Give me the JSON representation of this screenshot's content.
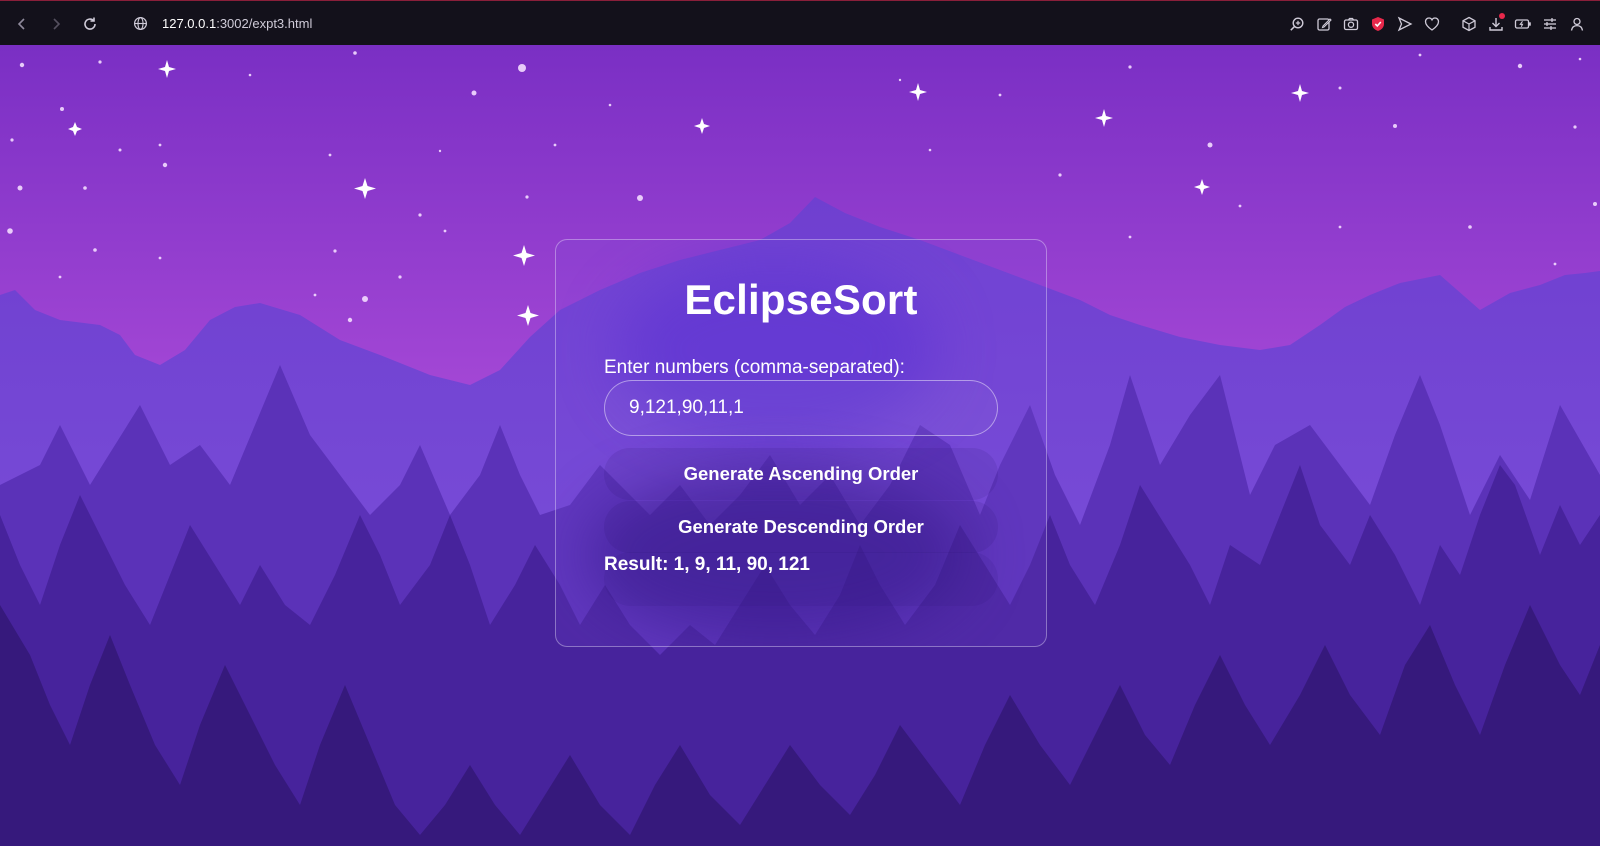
{
  "browser": {
    "url_host": "127.0.0.1",
    "url_path": ":3002/expt3.html",
    "icons": [
      "back-icon",
      "forward-icon",
      "reload-icon",
      "globe-icon",
      "zoom-icon",
      "edit-icon",
      "camera-icon",
      "shield-icon",
      "send-icon",
      "heart-icon",
      "cube-icon",
      "download-icon",
      "battery-icon",
      "sliders-icon",
      "profile-icon"
    ]
  },
  "app": {
    "title": "EclipseSort",
    "input_label": "Enter numbers (comma-separated):",
    "input_value": "9,121,90,11,1",
    "asc_button": "Generate Ascending Order",
    "desc_button": "Generate Descending Order",
    "result_text": "Result: 1, 9, 11, 90, 121"
  },
  "colors": {
    "sky_top": "#7a2fc4",
    "sky_bottom": "#c270dc",
    "mountain": "#7b46d6",
    "trees_back": "#5b32b8",
    "trees_mid": "#47239c",
    "trees_front": "#36197c",
    "chrome": "#13111b",
    "accent_red": "#e8284b"
  }
}
